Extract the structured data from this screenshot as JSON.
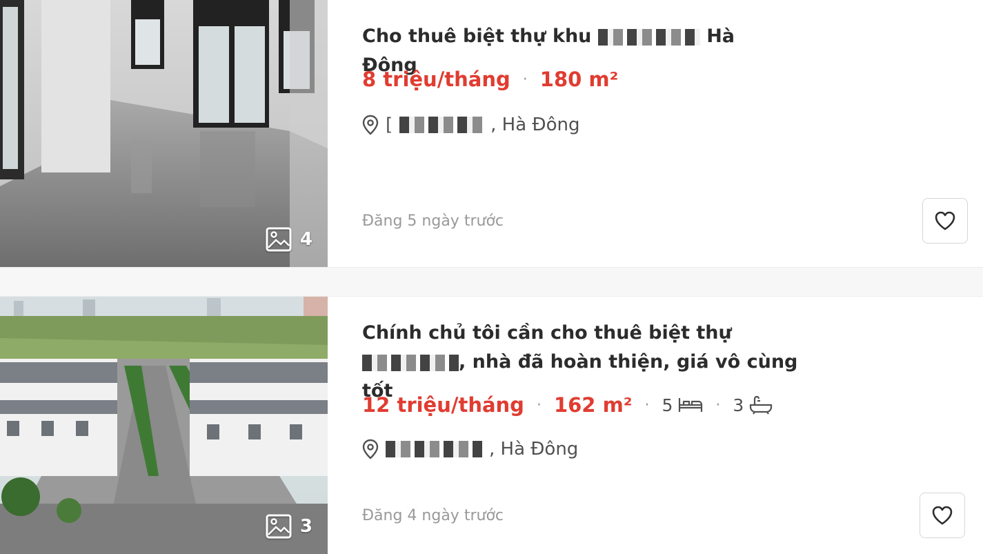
{
  "listings": [
    {
      "title_start": "Cho thuê biệt thự khu ",
      "title_end": " Hà Đông",
      "price": "8 triệu/tháng",
      "area": "180 m²",
      "location_start": "[",
      "location_end": ", Hà Đông",
      "posted": "Đăng 5 ngày trước",
      "photo_count": "4"
    },
    {
      "title_start": "Chính chủ tôi cần cho thuê biệt thự ",
      "title_end": ", nhà đã hoàn thiện, giá vô cùng tốt",
      "price": "12 triệu/tháng",
      "area": "162 m²",
      "bedrooms": "5",
      "bathrooms": "3",
      "location_end": ", Hà Đông",
      "posted": "Đăng 4 ngày trước",
      "photo_count": "3"
    }
  ],
  "colors": {
    "accent": "#e03c31",
    "muted": "#999999",
    "text": "#2c2c2c"
  },
  "icons": [
    "image-gallery-icon",
    "location-pin-icon",
    "heart-icon",
    "bed-icon",
    "bathtub-icon"
  ]
}
